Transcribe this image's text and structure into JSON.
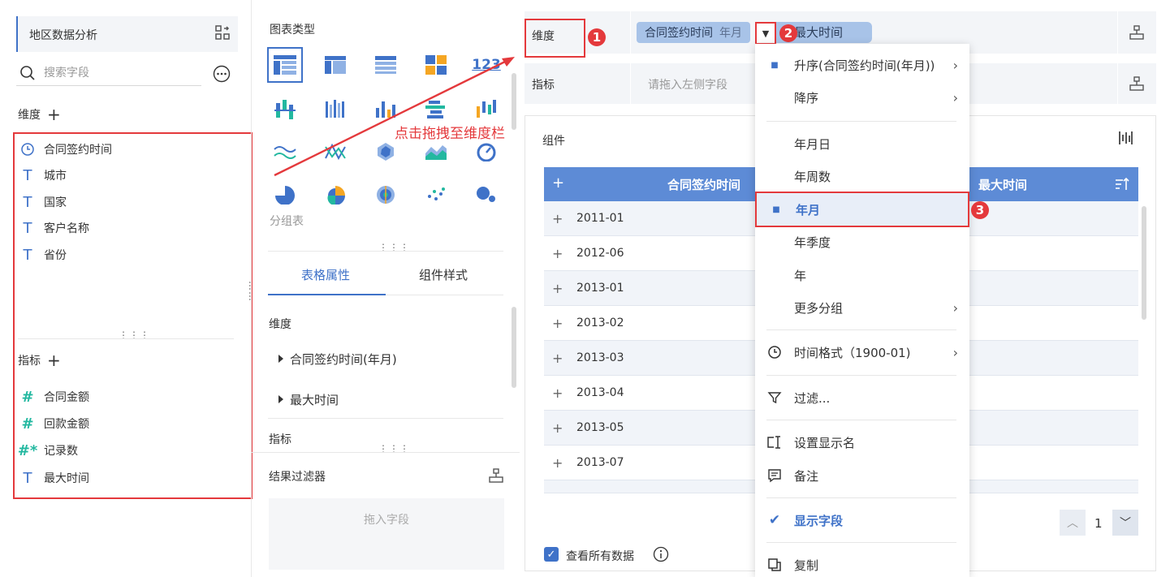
{
  "left": {
    "dataset_title": "地区数据分析",
    "search_placeholder": "搜索字段",
    "dimension_label": "维度",
    "dimension_fields": [
      "合同签约时间",
      "城市",
      "国家",
      "客户名称",
      "省份"
    ],
    "indicator_label": "指标",
    "indicator_fields": [
      "合同金额",
      "回款金额",
      "记录数",
      "最大时间"
    ]
  },
  "middle": {
    "chart_type_title": "图表类型",
    "chart_type_selected_label": "分组表",
    "tabs": [
      "表格属性",
      "组件样式"
    ],
    "prop_dimension": "维度",
    "prop_dim_items": [
      "合同签约时间(年月)",
      "最大时间"
    ],
    "prop_indicator": "指标",
    "result_filter": "结果过滤器",
    "drop_field": "拖入字段"
  },
  "right": {
    "dimension_row_label": "维度",
    "indicator_row_label": "指标",
    "indicator_placeholder": "请拖入左侧字段",
    "pill_field": "合同签约时间",
    "pill_sub": "年月",
    "pill2": "最大时间",
    "component_title": "组件",
    "table_header": [
      "合同签约时间",
      "最大时间"
    ],
    "table_rows": [
      "2011-01",
      "2012-06",
      "2013-01",
      "2013-02",
      "2013-03",
      "2013-04",
      "2013-05",
      "2013-07"
    ],
    "page_number": "1",
    "view_all_label": "查看所有数据"
  },
  "annotation": {
    "drag_hint": "点击拖拽至维度栏",
    "badges": [
      "1",
      "2",
      "3"
    ]
  },
  "menu": {
    "sort_asc": "升序(合同签约时间(年月))",
    "sort_desc": "降序",
    "ymd": "年月日",
    "yw": "年周数",
    "ym": "年月",
    "yq": "年季度",
    "y": "年",
    "more_group": "更多分组",
    "time_format": "时间格式（1900-01)",
    "filter": "过滤...",
    "set_display_name": "设置显示名",
    "remark": "备注",
    "show_field": "显示字段",
    "copy": "复制"
  },
  "colors": {
    "accent": "#3f72c8",
    "red": "#e4393c",
    "teal": "#23b8a0",
    "header_blue": "#5d8bd6"
  }
}
